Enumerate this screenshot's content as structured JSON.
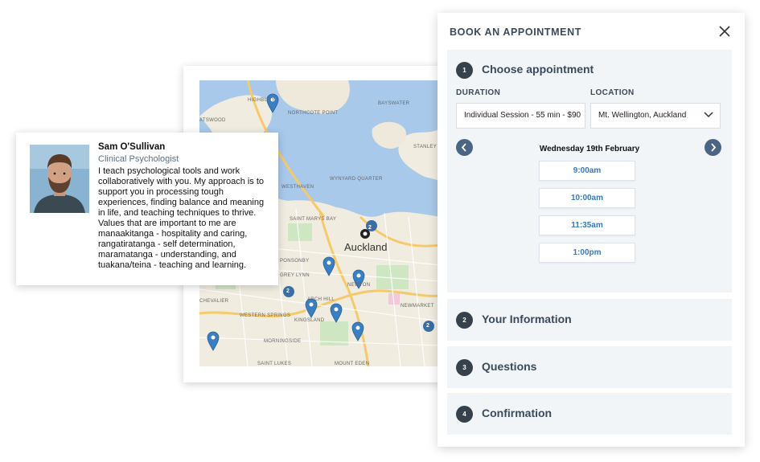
{
  "profile": {
    "name": "Sam O'Sullivan",
    "role": "Clinical Psychologist",
    "bio": "I teach psychological tools and work collaboratively with you. My approach is to support you in processing tough experiences, finding balance and meaning in life, and teaching techniques to thrive. Values that are important to me are manaakitanga - hospitality and caring, rangatiratanga - self determination, maramatanga - understanding, and tuakana/teina - teaching and learning."
  },
  "map": {
    "city_label": "Auckland",
    "labels": [
      "HIGHBURY",
      "NORTHCOTE POINT",
      "BAYSWATER",
      "STANLEY",
      "ATSWOOD",
      "WESTHAVEN",
      "WYNYARD QUARTER",
      "SAINT MARYS BAY",
      "PONSONBY",
      "GREY LYNN",
      "ARCH HILL",
      "NEWTON",
      "CHEVALIER",
      "WESTERN SPRINGS",
      "KINGSLAND",
      "NEWMARKET",
      "MORNINGSIDE",
      "SAINT LUKES",
      "MOUNT EDEN"
    ],
    "cluster_counts": [
      "2",
      "2",
      "2"
    ],
    "water_color": "#a9c9ea",
    "pin_color": "#3a7fc1"
  },
  "booking": {
    "title": "BOOK AN APPOINTMENT",
    "steps": [
      {
        "number": "1",
        "title": "Choose appointment"
      },
      {
        "number": "2",
        "title": "Your Information"
      },
      {
        "number": "3",
        "title": "Questions"
      },
      {
        "number": "4",
        "title": "Confirmation"
      }
    ],
    "duration_label": "DURATION",
    "duration_value": "Individual Session - 55 min - $90",
    "location_label": "LOCATION",
    "location_value": "Mt. Wellington, Auckland",
    "date": "Wednesday 19th February",
    "time_slots": [
      "9:00am",
      "10:00am",
      "11:35am",
      "1:00pm"
    ],
    "accent_color": "#3a78b8"
  }
}
